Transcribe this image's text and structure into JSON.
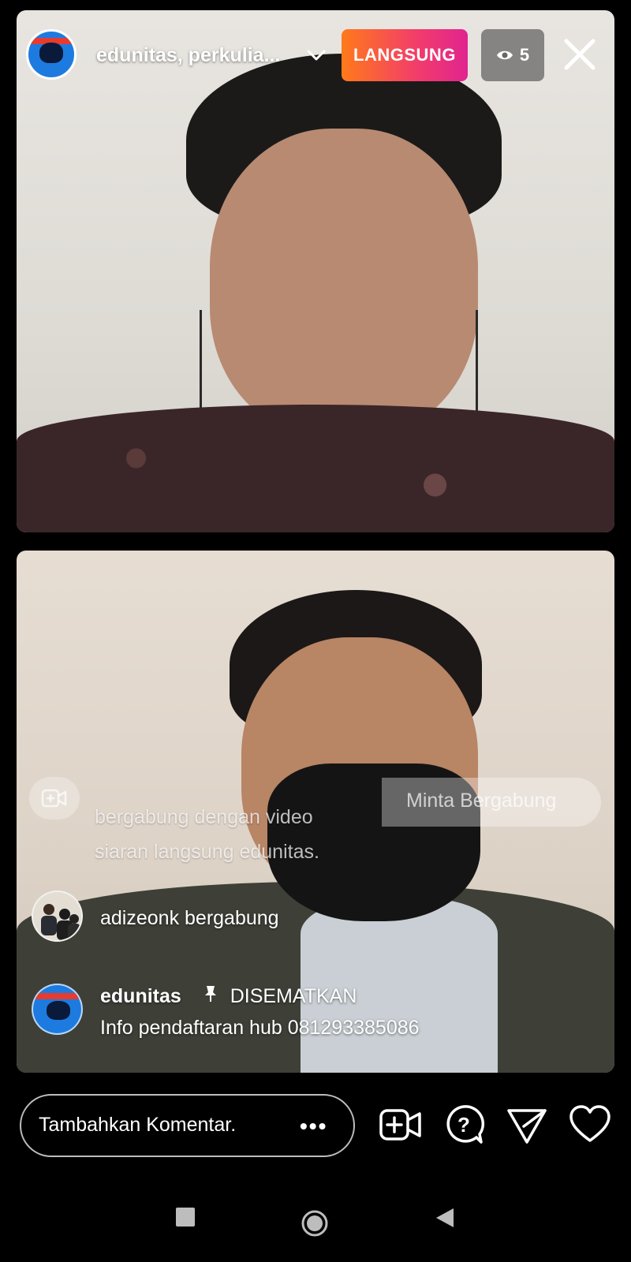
{
  "header": {
    "title": "edunitas, perkulia...",
    "live_label": "LANGSUNG",
    "viewer_count": "5"
  },
  "join_request": {
    "button_label": "Minta Bergabung",
    "line1": "bergabung dengan video",
    "line2": "siaran langsung edunitas."
  },
  "comments": [
    {
      "text": "adizeonk bergabung"
    },
    {
      "user": "edunitas",
      "pinned_label": "DISEMATKAN",
      "text": "Info pendaftaran hub 081293385086"
    }
  ],
  "bottom_bar": {
    "comment_placeholder": "Tambahkan Komentar.",
    "more_label": "•••"
  },
  "colors": {
    "live_gradient_start": "#ff7a1a",
    "live_gradient_end": "#e0248f",
    "background": "#000000"
  },
  "icons": [
    "chevron-down-icon",
    "eye-icon",
    "close-icon",
    "video-add-icon",
    "question-icon",
    "send-icon",
    "heart-icon",
    "recents-icon",
    "home-icon",
    "back-icon"
  ]
}
